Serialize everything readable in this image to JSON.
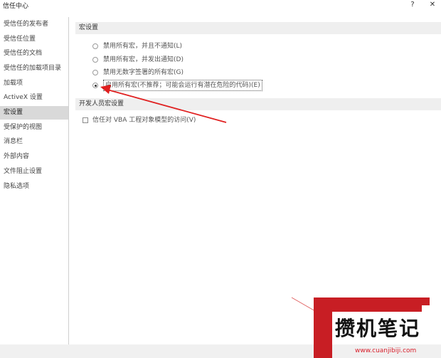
{
  "window": {
    "title": "信任中心",
    "help_label": "?",
    "close_label": "✕"
  },
  "sidebar": {
    "items": [
      {
        "label": "受信任的发布者"
      },
      {
        "label": "受信任位置"
      },
      {
        "label": "受信任的文档"
      },
      {
        "label": "受信任的加载项目录"
      },
      {
        "label": "加载项"
      },
      {
        "label": "ActiveX 设置"
      },
      {
        "label": "宏设置",
        "active": true
      },
      {
        "label": "受保护的视图"
      },
      {
        "label": "消息栏"
      },
      {
        "label": "外部内容"
      },
      {
        "label": "文件阻止设置"
      },
      {
        "label": "隐私选项"
      }
    ]
  },
  "macro_settings": {
    "header": "宏设置",
    "options": [
      {
        "label": "禁用所有宏，并且不通知(L)",
        "checked": false
      },
      {
        "label": "禁用所有宏，并发出通知(D)",
        "checked": false
      },
      {
        "label": "禁用无数字签署的所有宏(G)",
        "checked": false
      },
      {
        "label": "启用所有宏(不推荐；可能会运行有潜在危险的代码)(E)",
        "checked": true
      }
    ]
  },
  "developer_settings": {
    "header": "开发人员宏设置",
    "trust_vba_label": "信任对 VBA 工程对象模型的访问(V)",
    "trust_vba_checked": false
  },
  "watermark": {
    "brand": "攒机笔记",
    "url": "www.cuanjibiji.com",
    "accent_color": "#c81e24"
  }
}
